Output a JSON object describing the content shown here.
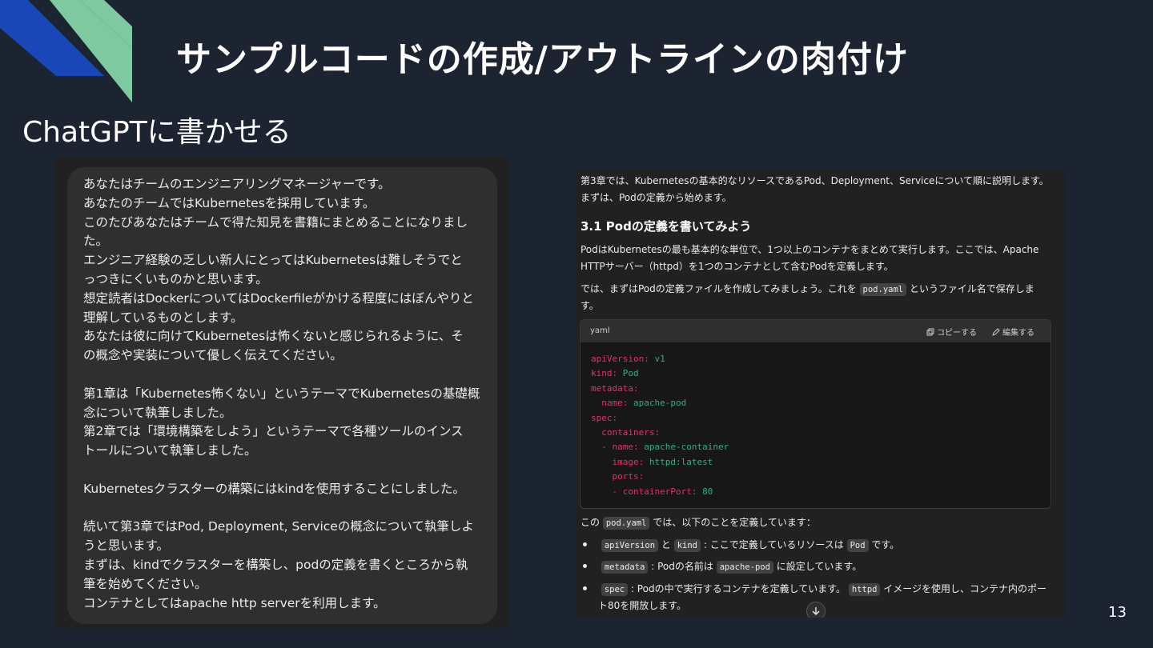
{
  "slide": {
    "title": "サンプルコードの作成/アウトラインの肉付け",
    "subtitle": "ChatGPTに書かせる",
    "page_number": "13",
    "colors": {
      "background": "#1c2331",
      "deco_blue": "#1a47b8",
      "deco_green": "#7fc9a1"
    }
  },
  "prompt": {
    "lines": [
      "あなたはチームのエンジニアリングマネージャーです。",
      "あなたのチームではKubernetesを採用しています。",
      "このたびあなたはチームで得た知見を書籍にまとめることになりまし",
      "た。",
      "エンジニア経験の乏しい新人にとってはKubernetesは難しそうでと",
      "っつきにくいものかと思います。",
      "想定読者はDockerについてはDockerfileがかける程度にはぼんやりと",
      "理解しているものとします。",
      "あなたは彼に向けてKubernetesは怖くないと感じられるように、そ",
      "の概念や実装について優しく伝えてください。",
      "",
      "第1章は「Kubernetes怖くない」というテーマでKubernetesの基礎概",
      "念について執筆しました。",
      "第2章では「環境構築をしよう」というテーマで各種ツールのインス",
      "トールについて執筆しました。",
      "",
      "Kubernetesクラスターの構築にはkindを使用することにしました。",
      "",
      "続いて第3章ではPod, Deployment, Serviceの概念について執筆しよ",
      "うと思います。",
      "まずは、kindでクラスターを構築し、podの定義を書くところから執",
      "筆を始めてください。",
      "コンテナとしてはapache http serverを利用します。"
    ]
  },
  "response": {
    "intro_line1": "第3章では、Kubernetesの基本的なリソースであるPod、Deployment、Serviceについて順に説明します。",
    "intro_line2": "まずは、Podの定義から始めます。",
    "heading": "3.1 Podの定義を書いてみよう",
    "para1_line1": "PodはKubernetesの最も基本的な単位で、1つ以上のコンテナをまとめて実行します。ここでは、Apache",
    "para1_line2": "HTTPサーバー（httpd）を1つのコンテナとして含むPodを定義します。",
    "para2_pre": "では、まずはPodの定義ファイルを作成してみましょう。これを",
    "para2_code": "pod.yaml",
    "para2_post": "というファイル名で保存しま",
    "para2_line2": "す。",
    "code": {
      "lang": "yaml",
      "copy_label": "コピーする",
      "edit_label": "編集する",
      "lines": [
        {
          "indent": "",
          "key": "apiVersion:",
          "value": " v1"
        },
        {
          "indent": "",
          "key": "kind:",
          "value": " Pod"
        },
        {
          "indent": "",
          "key": "metadata:",
          "value": ""
        },
        {
          "indent": "  ",
          "key": "name:",
          "value": " apache-pod"
        },
        {
          "indent": "",
          "key": "spec:",
          "value": ""
        },
        {
          "indent": "  ",
          "key": "containers:",
          "value": ""
        },
        {
          "indent": "  ",
          "key": "- name:",
          "value": " apache-container"
        },
        {
          "indent": "    ",
          "key": "image:",
          "value": " httpd:latest"
        },
        {
          "indent": "    ",
          "key": "ports:",
          "value": ""
        },
        {
          "indent": "    ",
          "key": "- containerPort:",
          "value": " 80"
        }
      ]
    },
    "after_code_pre": "この",
    "after_code_code": "pod.yaml",
    "after_code_post": "では、以下のことを定義しています：",
    "bullet1_code1": "apiVersion",
    "bullet1_mid": "と",
    "bullet1_code2": "kind",
    "bullet1_text": ": ここで定義しているリソースは",
    "bullet1_code3": "Pod",
    "bullet1_end": "です。",
    "bullet2_code1": "metadata",
    "bullet2_text": ": Podの名前は",
    "bullet2_code2": "apache-pod",
    "bullet2_end": "に設定しています。",
    "bullet3_code1": "spec",
    "bullet3_text": ": Podの中で実行するコンテナを定義しています。",
    "bullet3_code2": "httpd",
    "bullet3_end": "イメージを使用し、コンテナ内のポー",
    "bullet3_line2": "ト80を開放します。"
  }
}
